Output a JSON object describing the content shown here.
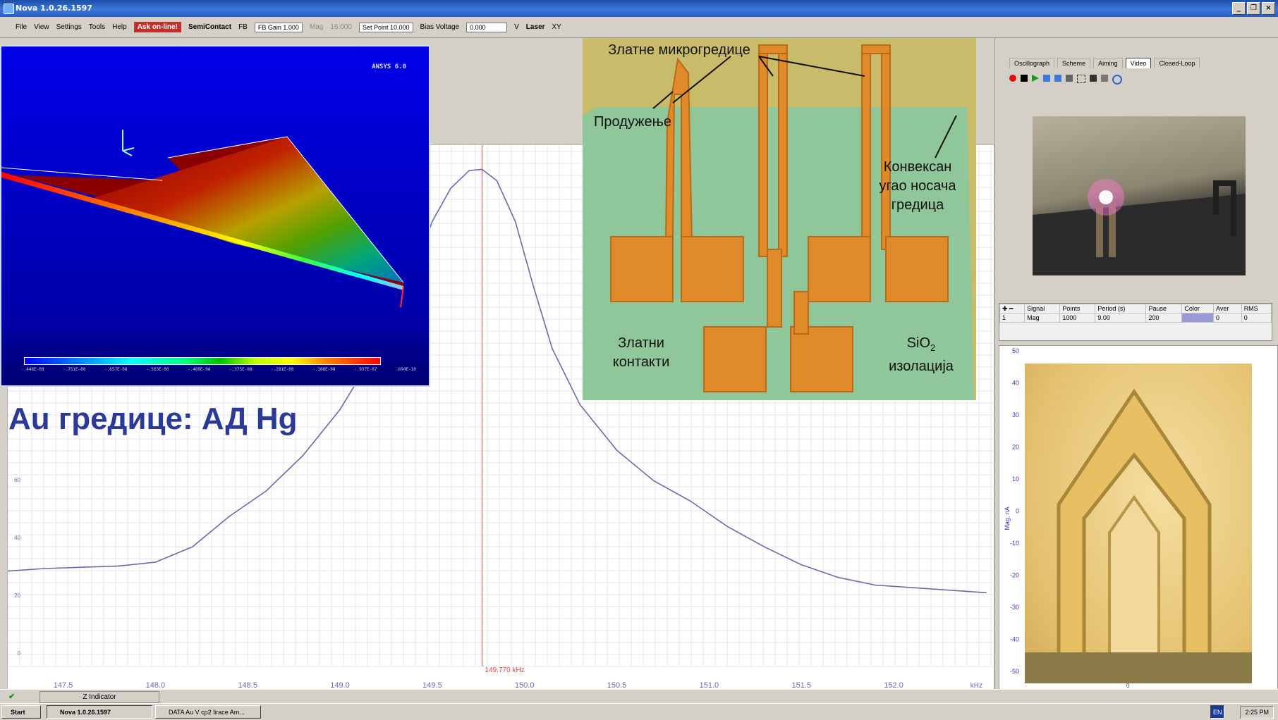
{
  "window": {
    "title": "Nova 1.0.26.1597",
    "controls": [
      "_",
      "❐",
      "×"
    ]
  },
  "menu": {
    "items": [
      "File",
      "View",
      "Settings",
      "Tools",
      "Help"
    ],
    "ask": "Ask on-line!",
    "mode": "SemiContact",
    "fb": "FB",
    "fb_gain": "FB Gain 1.000",
    "mag": "Mag",
    "dim_value": "16.000",
    "set_point": "Set Point 10.000",
    "bias_label": "Bias Voltage",
    "bias_value": "0.000",
    "bias_unit": "V",
    "laser": "Laser",
    "xy": "XY"
  },
  "heading": "Au гредице: АД Hg",
  "ansys": {
    "label": "ANSYS 6.0",
    "scale": [
      "-.446E-08",
      "-.751E-08",
      "-.657E-08",
      "-.563E-08",
      "-.469E-08",
      "-.375E-08",
      "-.281E-08",
      "-.188E-08",
      "-.937E-07",
      ".694E-10"
    ]
  },
  "chip_labels": {
    "beams": "Златне микрогредице",
    "extension": "Продужење",
    "corner": [
      "Конвексан",
      "угао носача",
      "гредица"
    ],
    "contacts": [
      "Златни",
      "контакти"
    ],
    "sio2": "SiO",
    "sio2_sub": "2",
    "isolation": "изолација"
  },
  "right_panel": {
    "tabs": [
      "Oscillograph",
      "Scheme",
      "Aiming",
      "Video",
      "Closed-Loop"
    ],
    "active_tab": "Video",
    "table_headers": [
      "Signal",
      "Points",
      "Period (s)",
      "Pause",
      "Color",
      "Aver",
      "RMS"
    ],
    "table_row": [
      "1",
      "Mag",
      "1000",
      "9.00",
      "200",
      "",
      "0",
      "0"
    ],
    "mag_axis_label": "Mag, nA",
    "mag_ticks": [
      "50",
      "40",
      "30",
      "20",
      "10",
      "0",
      "-10",
      "-20",
      "-30",
      "-40",
      "-50"
    ],
    "mag_bottom_label": "0"
  },
  "status": {
    "z_indicator": "Z Indicator"
  },
  "taskbar": {
    "start": "Start",
    "task1": "Nova 1.0.26.1597",
    "task2": "DATA Au V cp2 lirace Am...",
    "lang": "EN",
    "clock": "2:25 PM"
  },
  "chart_data": {
    "type": "line",
    "x_ticks": [
      "147.5",
      "148.0",
      "148.5",
      "149.0",
      "149.5",
      "150.0",
      "150.5",
      "151.0",
      "151.5",
      "152.0"
    ],
    "x_unit": "kHz",
    "y_ticks": [
      "60",
      "40",
      "20",
      "0"
    ],
    "peak_marker_label": "149.770 kHz",
    "peak_marker_x": 149.77,
    "xlim": [
      147.2,
      152.55
    ],
    "ylim": [
      -25,
      180
    ],
    "x": [
      147.2,
      147.4,
      147.6,
      147.8,
      148.0,
      148.2,
      148.4,
      148.6,
      148.8,
      149.0,
      149.2,
      149.4,
      149.5,
      149.6,
      149.7,
      149.77,
      149.85,
      149.95,
      150.05,
      150.15,
      150.3,
      150.5,
      150.7,
      150.9,
      151.1,
      151.3,
      151.5,
      151.7,
      151.9,
      152.1,
      152.3,
      152.5
    ],
    "y": [
      12.5,
      13.5,
      14,
      14.5,
      16,
      22,
      34,
      44,
      58,
      76,
      100,
      130,
      150,
      163,
      170,
      170.5,
      166,
      150,
      124,
      100,
      78,
      60,
      48,
      40,
      30,
      22,
      15,
      10,
      7,
      6,
      5,
      4
    ],
    "grid": true
  }
}
